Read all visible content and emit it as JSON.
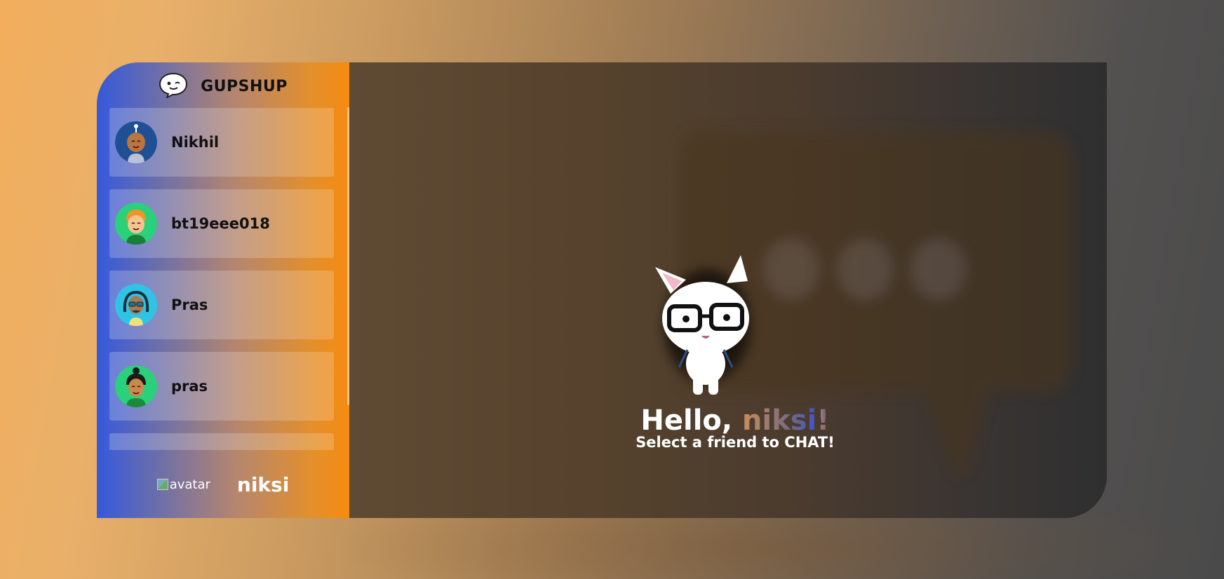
{
  "brand": {
    "title": "GUPSHUP",
    "icon": "chat-bubble-winking-icon"
  },
  "contacts": [
    {
      "name": "Nikhil",
      "avatar": "avatar-blue"
    },
    {
      "name": "bt19eee018",
      "avatar": "avatar-green-orange-hair"
    },
    {
      "name": "Pras",
      "avatar": "avatar-cyan-dreadlocks"
    },
    {
      "name": "pras",
      "avatar": "avatar-green-bun"
    },
    {
      "name": "",
      "avatar": ""
    }
  ],
  "current_user": {
    "avatar_alt": "avatar",
    "name": "niksi"
  },
  "welcome": {
    "greeting_prefix": "Hello, ",
    "greeting_name": "niksi",
    "greeting_suffix": "!",
    "subtitle": "Select a friend to CHAT!"
  },
  "colors": {
    "accent_blue": "#3559dc",
    "accent_orange": "#f68b10"
  }
}
